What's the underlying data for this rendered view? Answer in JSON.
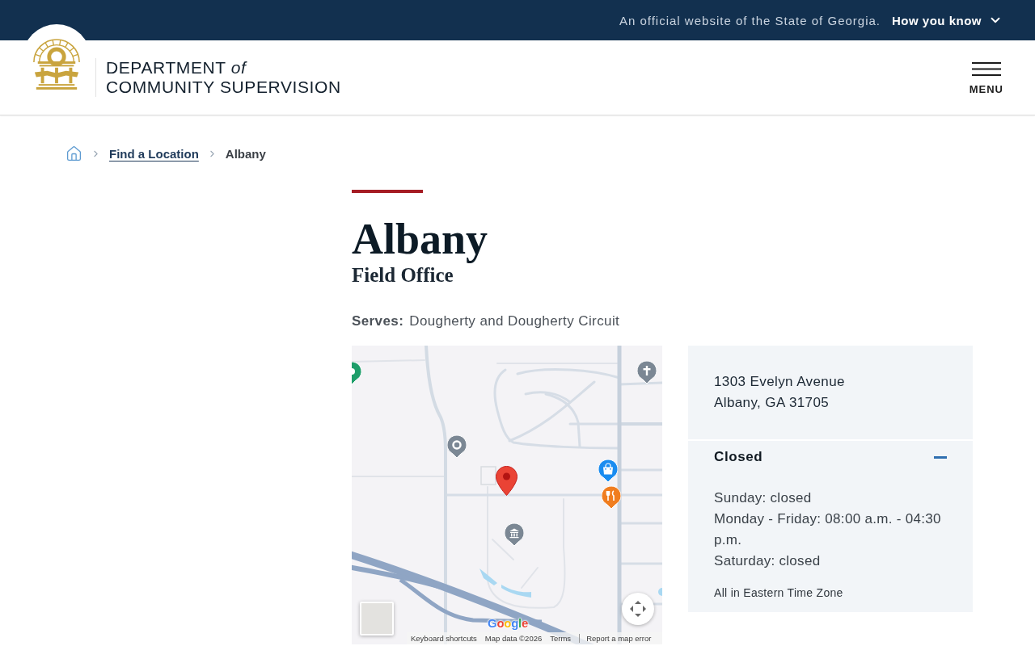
{
  "top_bar": {
    "notice": "An official website of the State of Georgia.",
    "toggle": {
      "label": "How you know",
      "expanded": false
    }
  },
  "header": {
    "title_lines": [
      "DEPARTMENT *of*",
      "COMMUNITY SUPERVISION"
    ],
    "menu_label": "MENU"
  },
  "breadcrumb": [
    {
      "kind": "home"
    },
    {
      "kind": "link",
      "label": "Find a Location"
    },
    {
      "kind": "current",
      "label": "Albany"
    }
  ],
  "page": {
    "title": "Albany",
    "subtitle": "Field Office",
    "serves": {
      "label": "Serves:",
      "value": "Dougherty and Dougherty Circuit"
    }
  },
  "map": {
    "logo": "Google",
    "attribution": [
      "Keyboard shortcuts",
      "Map data ©2026",
      "Terms",
      "Report a map error"
    ]
  },
  "location_card": {
    "address": [
      "1303 Evelyn Avenue",
      "Albany, GA 31705"
    ],
    "hours": {
      "status": "Closed",
      "expanded": true,
      "lines": [
        "Sunday: closed",
        "Monday - Friday: 08:00 a.m. - 04:30 p.m.",
        "Saturday: closed"
      ],
      "note": "All in Eastern Time Zone"
    }
  }
}
